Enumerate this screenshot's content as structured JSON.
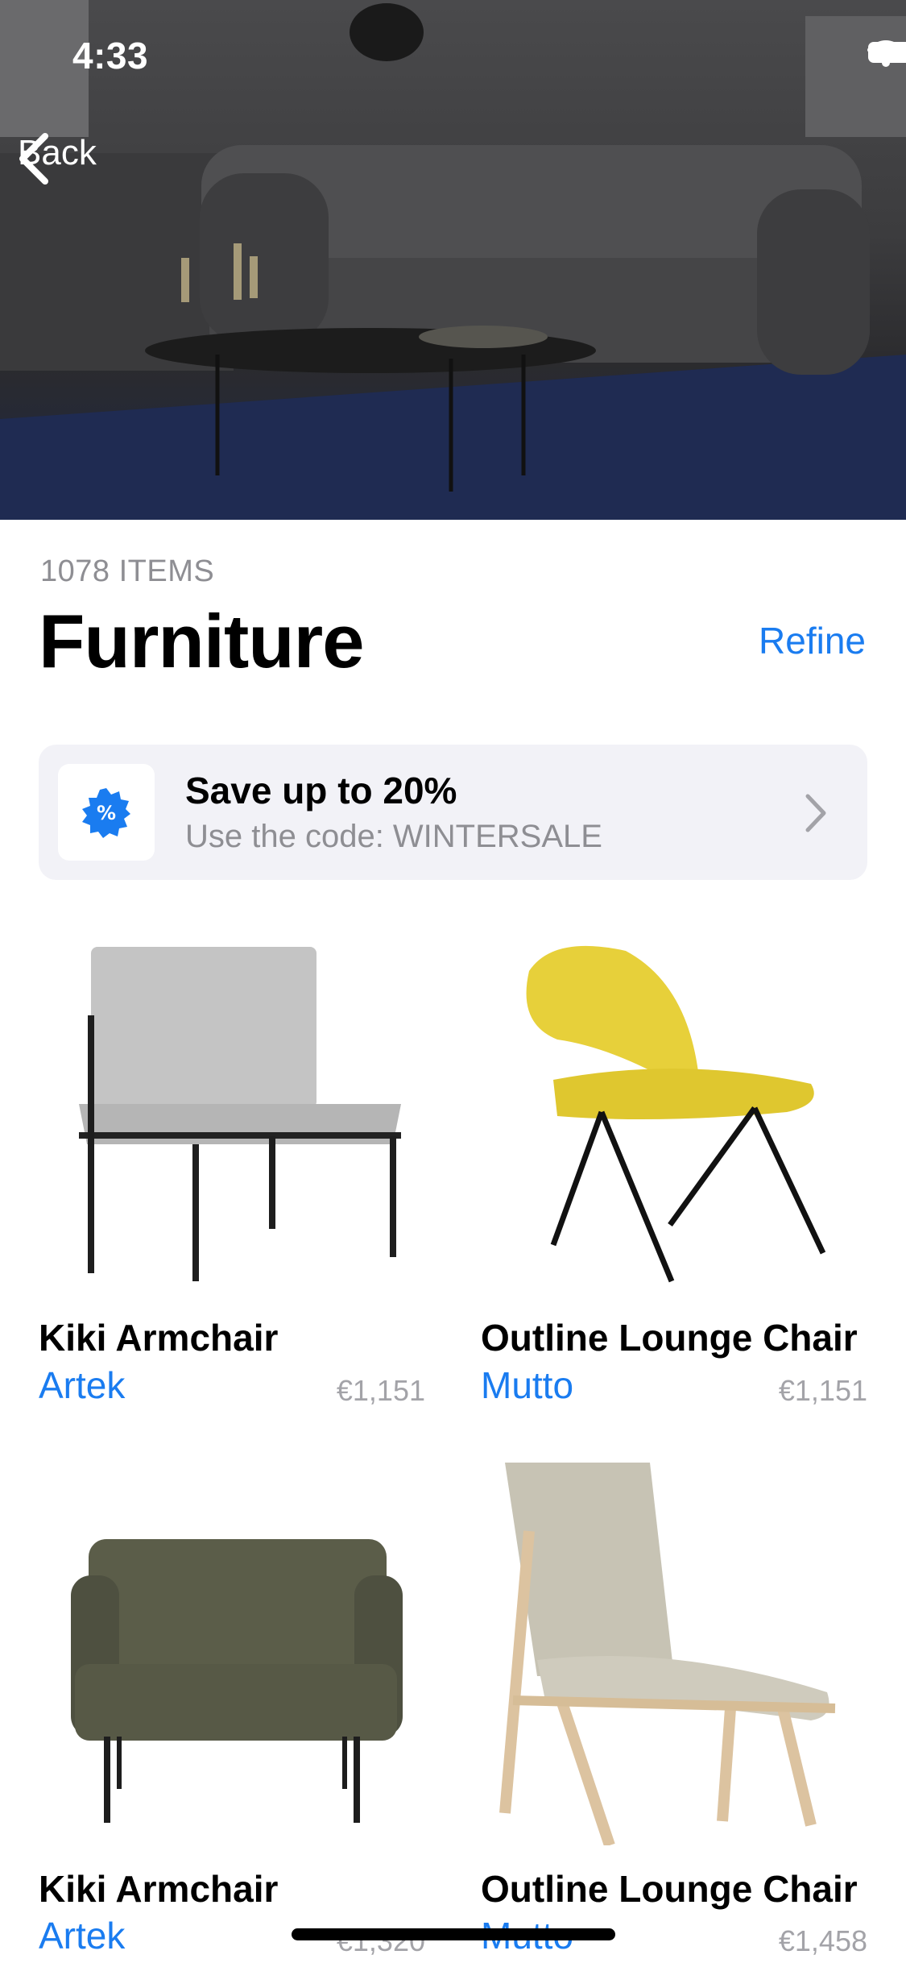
{
  "status_bar": {
    "time": "4:33"
  },
  "nav": {
    "back_label": "Back"
  },
  "header": {
    "items_count": "1078 ITEMS",
    "title": "Furniture",
    "refine_label": "Refine"
  },
  "promo": {
    "icon": "percent-badge-icon",
    "title": "Save up to 20%",
    "subtitle": "Use the code: WINTERSALE"
  },
  "products": [
    {
      "name": "Kiki Armchair",
      "brand": "Artek",
      "price": "€1,151"
    },
    {
      "name": "Outline Lounge Chair",
      "brand": "Mutto",
      "price": "€1,151"
    },
    {
      "name": "Kiki Armchair",
      "brand": "Artek",
      "price": "€1,320"
    },
    {
      "name": "Outline Lounge Chair",
      "brand": "Mutto",
      "price": "€1,458"
    }
  ],
  "colors": {
    "accent": "#1a7cf0",
    "secondary_text": "#8e8e93",
    "promo_bg": "#f2f2f7"
  }
}
